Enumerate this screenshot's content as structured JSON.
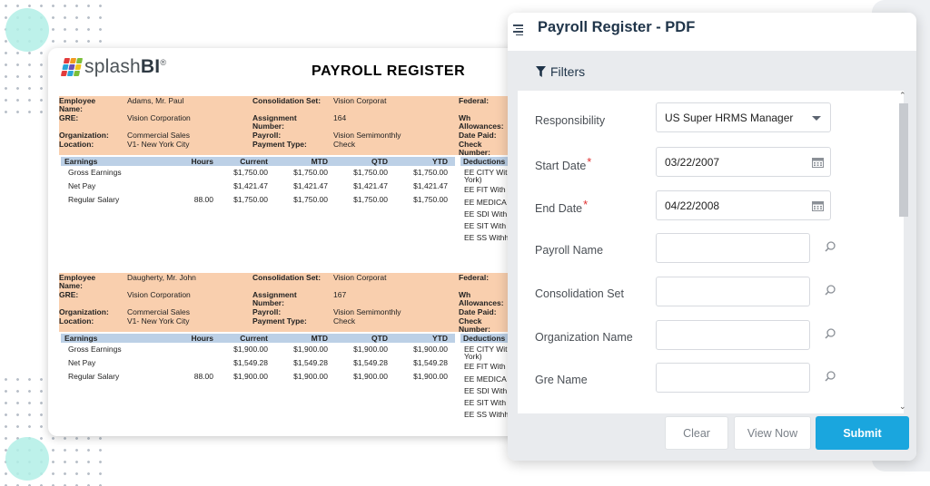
{
  "report": {
    "logo_text_light": "splash",
    "logo_text_bold": "BI",
    "logo_reg": "®",
    "title": "PAYROLL REGISTER",
    "labels": {
      "employee_name": "Employee Name:",
      "gre": "GRE:",
      "organization": "Organization:",
      "location": "Location:",
      "consolidation_set": "Consolidation Set:",
      "assignment_number": "Assignment Number:",
      "payroll": "Payroll:",
      "payment_type": "Payment Type:",
      "federal": "Federal:",
      "wh_allowances": "Wh Allowances:",
      "date_paid": "Date Paid:",
      "check_number": "Check Number:"
    },
    "earnings_headers": [
      "Earnings",
      "Hours",
      "Current",
      "MTD",
      "QTD",
      "YTD",
      "Deductions"
    ],
    "employees": [
      {
        "name": "Adams, Mr. Paul",
        "gre": "Vision Corporation",
        "organization": "Commercial Sales",
        "location": "V1- New York City",
        "consolidation_set": "Vision Corporat",
        "assignment_number": "164",
        "payroll": "Vision Semimonthly",
        "payment_type": "Check",
        "earnings": [
          {
            "name": "Gross Earnings",
            "hours": "",
            "current": "$1,750.00",
            "mtd": "$1,750.00",
            "qtd": "$1,750.00",
            "ytd": "$1,750.00"
          },
          {
            "name": "Net Pay",
            "hours": "",
            "current": "$1,421.47",
            "mtd": "$1,421.47",
            "qtd": "$1,421.47",
            "ytd": "$1,421.47"
          },
          {
            "name": "Regular Salary",
            "hours": "88.00",
            "current": "$1,750.00",
            "mtd": "$1,750.00",
            "qtd": "$1,750.00",
            "ytd": "$1,750.00"
          }
        ],
        "deductions": [
          "EE CITY With",
          "York)",
          "EE FIT With",
          "EE MEDICA",
          "EE SDI With",
          "EE SIT With",
          "EE SS Withh"
        ]
      },
      {
        "name": "Daugherty, Mr. John",
        "gre": "Vision Corporation",
        "organization": "Commercial Sales",
        "location": "V1- New York City",
        "consolidation_set": "Vision Corporat",
        "assignment_number": "167",
        "payroll": "Vision Semimonthly",
        "payment_type": "Check",
        "earnings": [
          {
            "name": "Gross Earnings",
            "hours": "",
            "current": "$1,900.00",
            "mtd": "$1,900.00",
            "qtd": "$1,900.00",
            "ytd": "$1,900.00"
          },
          {
            "name": "Net Pay",
            "hours": "",
            "current": "$1,549.28",
            "mtd": "$1,549.28",
            "qtd": "$1,549.28",
            "ytd": "$1,549.28"
          },
          {
            "name": "Regular Salary",
            "hours": "88.00",
            "current": "$1,900.00",
            "mtd": "$1,900.00",
            "qtd": "$1,900.00",
            "ytd": "$1,900.00"
          }
        ],
        "deductions": [
          "EE CITY With",
          "York)",
          "EE FIT With",
          "EE MEDICA",
          "EE SDI With",
          "EE SIT With",
          "EE SS Withh"
        ]
      }
    ]
  },
  "panel": {
    "title": "Payroll Register - PDF",
    "filters_label": "Filters",
    "fields": {
      "responsibility": {
        "label": "Responsibility",
        "value": "US Super HRMS Manager"
      },
      "start_date": {
        "label": "Start Date",
        "required": "*",
        "value": "03/22/2007"
      },
      "end_date": {
        "label": "End Date",
        "required": "*",
        "value": "04/22/2008"
      },
      "payroll_name": {
        "label": "Payroll Name",
        "value": ""
      },
      "consolidation_set": {
        "label": "Consolidation Set",
        "value": ""
      },
      "organization_name": {
        "label": "Organization Name",
        "value": ""
      },
      "gre_name": {
        "label": "Gre Name",
        "value": ""
      }
    },
    "buttons": {
      "clear": "Clear",
      "view_now": "View Now",
      "submit": "Submit"
    }
  },
  "colors": {
    "accent": "#1aa6de",
    "header_band": "#f9cfae",
    "table_header": "#bcd0e6",
    "logo_tiles": [
      "#e23b3b",
      "#f29a1f",
      "#7bbf3a",
      "#2aa5d8",
      "#6b4fb4",
      "#f0c419",
      "#e23b3b",
      "#2aa5d8",
      "#7bbf3a"
    ]
  },
  "icons": [
    "menu-icon",
    "filter-icon",
    "chevron-down-icon",
    "calendar-icon",
    "search-icon",
    "scroll-up-icon",
    "scroll-down-icon"
  ]
}
